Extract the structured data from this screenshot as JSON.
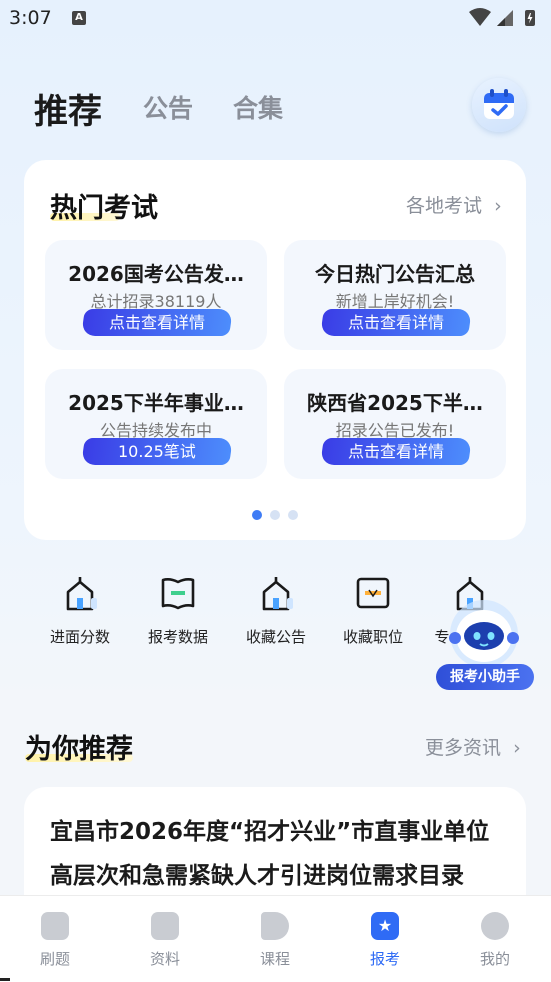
{
  "status": {
    "time": "3:07",
    "a_icon": "A"
  },
  "header": {
    "tabs": [
      "推荐",
      "公告",
      "合集"
    ],
    "active_tab": "推荐"
  },
  "hot": {
    "title": "热门考试",
    "more": "各地考试",
    "tiles": [
      {
        "title": "2026国考公告发…",
        "subtitle": "总计招录38119人",
        "button": "点击查看详情"
      },
      {
        "title": "今日热门公告汇总",
        "subtitle": "新增上岸好机会!",
        "button": "点击查看详情"
      },
      {
        "title": "2025下半年事业…",
        "subtitle": "公告持续发布中",
        "button": "10.25笔试"
      },
      {
        "title": "陕西省2025下半…",
        "subtitle": "招录公告已发布!",
        "button": "点击查看详情"
      }
    ],
    "page_indicator": {
      "current": 1,
      "total": 3
    }
  },
  "quick_entries": [
    {
      "label": "进面分数",
      "icon": "school-icon"
    },
    {
      "label": "报考数据",
      "icon": "book-icon"
    },
    {
      "label": "收藏公告",
      "icon": "school-icon"
    },
    {
      "label": "收藏职位",
      "icon": "briefcase-icon"
    },
    {
      "label": "专",
      "icon": "school-icon"
    }
  ],
  "assistant": {
    "label": "报考小助手"
  },
  "recommend": {
    "title": "为你推荐",
    "more": "更多资讯",
    "article_title": "宜昌市2026年度“招才兴业”市直事业单位高层次和急需紧缺人才引进岗位需求目录"
  },
  "bottom_nav": {
    "items": [
      {
        "label": "刷题",
        "icon": "pen-icon"
      },
      {
        "label": "资料",
        "icon": "document-icon"
      },
      {
        "label": "课程",
        "icon": "play-icon"
      },
      {
        "label": "报考",
        "icon": "star-icon"
      },
      {
        "label": "我的",
        "icon": "face-icon"
      }
    ],
    "active": "报考"
  },
  "colors": {
    "accent": "#2f6bf5",
    "button_start": "#3a3de6",
    "button_end": "#4d8dfc",
    "highlight": "#fff2a8"
  }
}
